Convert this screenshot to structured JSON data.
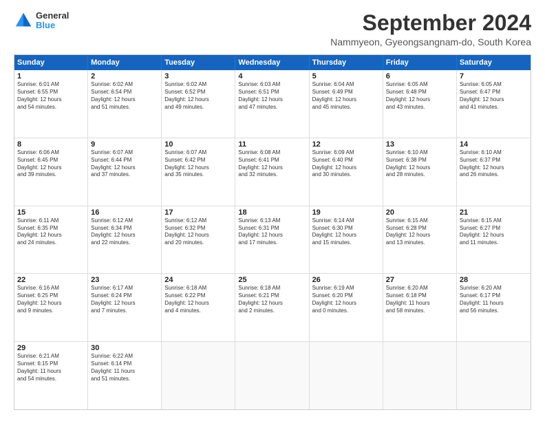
{
  "logo": {
    "general": "General",
    "blue": "Blue"
  },
  "title": "September 2024",
  "subtitle": "Nammyeon, Gyeongsangnam-do, South Korea",
  "headers": [
    "Sunday",
    "Monday",
    "Tuesday",
    "Wednesday",
    "Thursday",
    "Friday",
    "Saturday"
  ],
  "weeks": [
    [
      {
        "day": "1",
        "lines": [
          "Sunrise: 6:01 AM",
          "Sunset: 6:55 PM",
          "Daylight: 12 hours",
          "and 54 minutes."
        ]
      },
      {
        "day": "2",
        "lines": [
          "Sunrise: 6:02 AM",
          "Sunset: 6:54 PM",
          "Daylight: 12 hours",
          "and 51 minutes."
        ]
      },
      {
        "day": "3",
        "lines": [
          "Sunrise: 6:02 AM",
          "Sunset: 6:52 PM",
          "Daylight: 12 hours",
          "and 49 minutes."
        ]
      },
      {
        "day": "4",
        "lines": [
          "Sunrise: 6:03 AM",
          "Sunset: 6:51 PM",
          "Daylight: 12 hours",
          "and 47 minutes."
        ]
      },
      {
        "day": "5",
        "lines": [
          "Sunrise: 6:04 AM",
          "Sunset: 6:49 PM",
          "Daylight: 12 hours",
          "and 45 minutes."
        ]
      },
      {
        "day": "6",
        "lines": [
          "Sunrise: 6:05 AM",
          "Sunset: 6:48 PM",
          "Daylight: 12 hours",
          "and 43 minutes."
        ]
      },
      {
        "day": "7",
        "lines": [
          "Sunrise: 6:05 AM",
          "Sunset: 6:47 PM",
          "Daylight: 12 hours",
          "and 41 minutes."
        ]
      }
    ],
    [
      {
        "day": "8",
        "lines": [
          "Sunrise: 6:06 AM",
          "Sunset: 6:45 PM",
          "Daylight: 12 hours",
          "and 39 minutes."
        ]
      },
      {
        "day": "9",
        "lines": [
          "Sunrise: 6:07 AM",
          "Sunset: 6:44 PM",
          "Daylight: 12 hours",
          "and 37 minutes."
        ]
      },
      {
        "day": "10",
        "lines": [
          "Sunrise: 6:07 AM",
          "Sunset: 6:42 PM",
          "Daylight: 12 hours",
          "and 35 minutes."
        ]
      },
      {
        "day": "11",
        "lines": [
          "Sunrise: 6:08 AM",
          "Sunset: 6:41 PM",
          "Daylight: 12 hours",
          "and 32 minutes."
        ]
      },
      {
        "day": "12",
        "lines": [
          "Sunrise: 6:09 AM",
          "Sunset: 6:40 PM",
          "Daylight: 12 hours",
          "and 30 minutes."
        ]
      },
      {
        "day": "13",
        "lines": [
          "Sunrise: 6:10 AM",
          "Sunset: 6:38 PM",
          "Daylight: 12 hours",
          "and 28 minutes."
        ]
      },
      {
        "day": "14",
        "lines": [
          "Sunrise: 6:10 AM",
          "Sunset: 6:37 PM",
          "Daylight: 12 hours",
          "and 26 minutes."
        ]
      }
    ],
    [
      {
        "day": "15",
        "lines": [
          "Sunrise: 6:11 AM",
          "Sunset: 6:35 PM",
          "Daylight: 12 hours",
          "and 24 minutes."
        ]
      },
      {
        "day": "16",
        "lines": [
          "Sunrise: 6:12 AM",
          "Sunset: 6:34 PM",
          "Daylight: 12 hours",
          "and 22 minutes."
        ]
      },
      {
        "day": "17",
        "lines": [
          "Sunrise: 6:12 AM",
          "Sunset: 6:32 PM",
          "Daylight: 12 hours",
          "and 20 minutes."
        ]
      },
      {
        "day": "18",
        "lines": [
          "Sunrise: 6:13 AM",
          "Sunset: 6:31 PM",
          "Daylight: 12 hours",
          "and 17 minutes."
        ]
      },
      {
        "day": "19",
        "lines": [
          "Sunrise: 6:14 AM",
          "Sunset: 6:30 PM",
          "Daylight: 12 hours",
          "and 15 minutes."
        ]
      },
      {
        "day": "20",
        "lines": [
          "Sunrise: 6:15 AM",
          "Sunset: 6:28 PM",
          "Daylight: 12 hours",
          "and 13 minutes."
        ]
      },
      {
        "day": "21",
        "lines": [
          "Sunrise: 6:15 AM",
          "Sunset: 6:27 PM",
          "Daylight: 12 hours",
          "and 11 minutes."
        ]
      }
    ],
    [
      {
        "day": "22",
        "lines": [
          "Sunrise: 6:16 AM",
          "Sunset: 6:25 PM",
          "Daylight: 12 hours",
          "and 9 minutes."
        ]
      },
      {
        "day": "23",
        "lines": [
          "Sunrise: 6:17 AM",
          "Sunset: 6:24 PM",
          "Daylight: 12 hours",
          "and 7 minutes."
        ]
      },
      {
        "day": "24",
        "lines": [
          "Sunrise: 6:18 AM",
          "Sunset: 6:22 PM",
          "Daylight: 12 hours",
          "and 4 minutes."
        ]
      },
      {
        "day": "25",
        "lines": [
          "Sunrise: 6:18 AM",
          "Sunset: 6:21 PM",
          "Daylight: 12 hours",
          "and 2 minutes."
        ]
      },
      {
        "day": "26",
        "lines": [
          "Sunrise: 6:19 AM",
          "Sunset: 6:20 PM",
          "Daylight: 12 hours",
          "and 0 minutes."
        ]
      },
      {
        "day": "27",
        "lines": [
          "Sunrise: 6:20 AM",
          "Sunset: 6:18 PM",
          "Daylight: 11 hours",
          "and 58 minutes."
        ]
      },
      {
        "day": "28",
        "lines": [
          "Sunrise: 6:20 AM",
          "Sunset: 6:17 PM",
          "Daylight: 11 hours",
          "and 56 minutes."
        ]
      }
    ],
    [
      {
        "day": "29",
        "lines": [
          "Sunrise: 6:21 AM",
          "Sunset: 6:15 PM",
          "Daylight: 11 hours",
          "and 54 minutes."
        ]
      },
      {
        "day": "30",
        "lines": [
          "Sunrise: 6:22 AM",
          "Sunset: 6:14 PM",
          "Daylight: 11 hours",
          "and 51 minutes."
        ]
      },
      {
        "day": "",
        "lines": []
      },
      {
        "day": "",
        "lines": []
      },
      {
        "day": "",
        "lines": []
      },
      {
        "day": "",
        "lines": []
      },
      {
        "day": "",
        "lines": []
      }
    ]
  ]
}
